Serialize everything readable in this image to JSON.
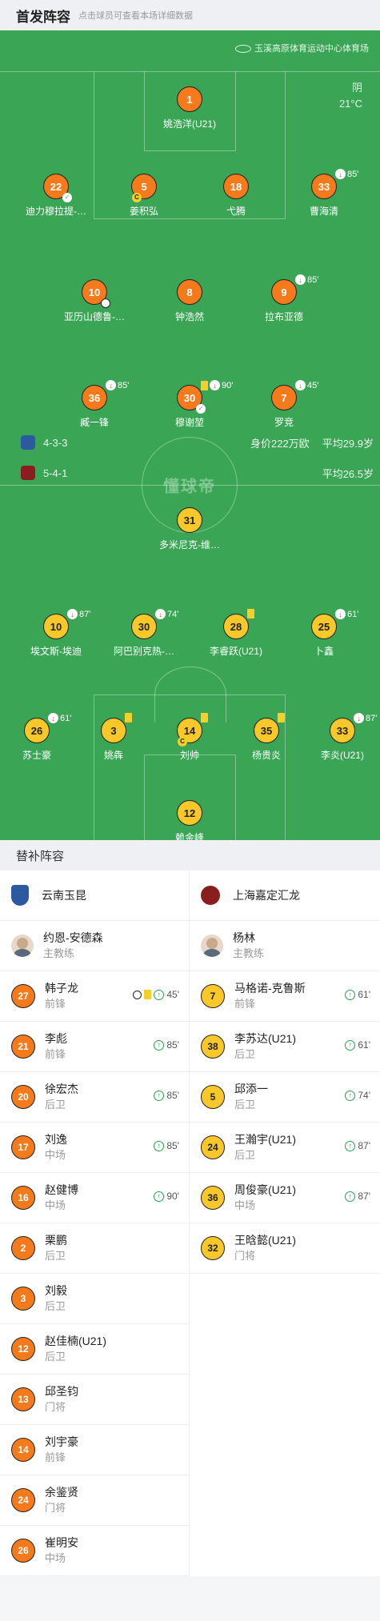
{
  "header": {
    "title": "首发阵容",
    "subtitle": "点击球员可查看本场详细数据"
  },
  "venue": "玉溪高原体育运动中心体育场",
  "weather": {
    "condition": "阴",
    "temp": "21°C"
  },
  "watermark": "懂球帝",
  "home": {
    "formation": "4-3-3",
    "value": "身价222万欧",
    "avg_age": "平均29.9岁",
    "crest_color": "#2c5aa0"
  },
  "away": {
    "formation": "5-4-1",
    "avg_age": "平均26.5岁",
    "crest_color": "#8a1e1e"
  },
  "pitch_players": [
    {
      "num": "1",
      "name": "姚浩洋(U21)",
      "color": "or"
    },
    {
      "num": "22",
      "name": "迪力穆拉提-…",
      "color": "or",
      "assist": true
    },
    {
      "num": "5",
      "name": "姜积弘",
      "color": "or",
      "captain": true
    },
    {
      "num": "18",
      "name": "弋腾",
      "color": "or"
    },
    {
      "num": "33",
      "name": "曹海清",
      "color": "or",
      "sub_out": "85'"
    },
    {
      "num": "10",
      "name": "亚历山德鲁-…",
      "color": "or",
      "goal": true
    },
    {
      "num": "8",
      "name": "钟浩然",
      "color": "or"
    },
    {
      "num": "9",
      "name": "拉布亚德",
      "color": "or",
      "sub_out": "85'"
    },
    {
      "num": "36",
      "name": "臧一锋",
      "color": "or",
      "sub_out": "85'"
    },
    {
      "num": "30",
      "name": "穆谢堃",
      "color": "or",
      "card": true,
      "sub_out": "90'",
      "assist": true
    },
    {
      "num": "7",
      "name": "罗竞",
      "color": "or",
      "sub_out": "45'"
    },
    {
      "num": "31",
      "name": "多米尼克-维…",
      "color": "ye"
    },
    {
      "num": "10",
      "name": "埃文斯-埃迪",
      "color": "ye",
      "sub_out": "87'"
    },
    {
      "num": "30",
      "name": "阿巴别克热-…",
      "color": "ye",
      "sub_out": "74'"
    },
    {
      "num": "28",
      "name": "李睿跃(U21)",
      "color": "ye",
      "card": true
    },
    {
      "num": "25",
      "name": "卜鑫",
      "color": "ye",
      "sub_out": "61'"
    },
    {
      "num": "26",
      "name": "苏士豪",
      "color": "ye",
      "sub_out": "61'"
    },
    {
      "num": "3",
      "name": "姚犇",
      "color": "ye",
      "card": true
    },
    {
      "num": "14",
      "name": "刘帅",
      "color": "ye",
      "card": true,
      "captain": true
    },
    {
      "num": "35",
      "name": "杨贵炎",
      "color": "ye",
      "card": true
    },
    {
      "num": "33",
      "name": "李炎(U21)",
      "color": "ye",
      "sub_out": "87'"
    },
    {
      "num": "12",
      "name": "赖金峰",
      "color": "ye"
    }
  ],
  "bench_title": "替补阵容",
  "bench": {
    "home": {
      "team": "云南玉昆",
      "coach": {
        "name": "约恩-安德森",
        "role": "主教练"
      },
      "players": [
        {
          "num": "27",
          "name": "韩子龙",
          "pos": "前锋",
          "goal": true,
          "card": true,
          "sub_in": "45'"
        },
        {
          "num": "21",
          "name": "李彪",
          "pos": "前锋",
          "sub_in": "85'"
        },
        {
          "num": "20",
          "name": "徐宏杰",
          "pos": "后卫",
          "sub_in": "85'"
        },
        {
          "num": "17",
          "name": "刘逸",
          "pos": "中场",
          "sub_in": "85'"
        },
        {
          "num": "16",
          "name": "赵健博",
          "pos": "中场",
          "sub_in": "90'"
        },
        {
          "num": "2",
          "name": "栗鹏",
          "pos": "后卫"
        },
        {
          "num": "3",
          "name": "刘毅",
          "pos": "后卫"
        },
        {
          "num": "12",
          "name": "赵佳楠(U21)",
          "pos": "后卫"
        },
        {
          "num": "13",
          "name": "邱圣钧",
          "pos": "门将"
        },
        {
          "num": "14",
          "name": "刘宇豪",
          "pos": "前锋"
        },
        {
          "num": "24",
          "name": "余鉴贤",
          "pos": "门将"
        },
        {
          "num": "26",
          "name": "崔明安",
          "pos": "中场"
        }
      ]
    },
    "away": {
      "team": "上海嘉定汇龙",
      "coach": {
        "name": "杨林",
        "role": "主教练"
      },
      "players": [
        {
          "num": "7",
          "name": "马格诺-克鲁斯",
          "pos": "前锋",
          "sub_in": "61'"
        },
        {
          "num": "38",
          "name": "李苏达(U21)",
          "pos": "后卫",
          "sub_in": "61'"
        },
        {
          "num": "5",
          "name": "邱添一",
          "pos": "后卫",
          "sub_in": "74'"
        },
        {
          "num": "24",
          "name": "王瀚宇(U21)",
          "pos": "后卫",
          "sub_in": "87'"
        },
        {
          "num": "36",
          "name": "周俊豪(U21)",
          "pos": "中场",
          "sub_in": "87'"
        },
        {
          "num": "32",
          "name": "王晗懿(U21)",
          "pos": "门将"
        }
      ]
    }
  }
}
